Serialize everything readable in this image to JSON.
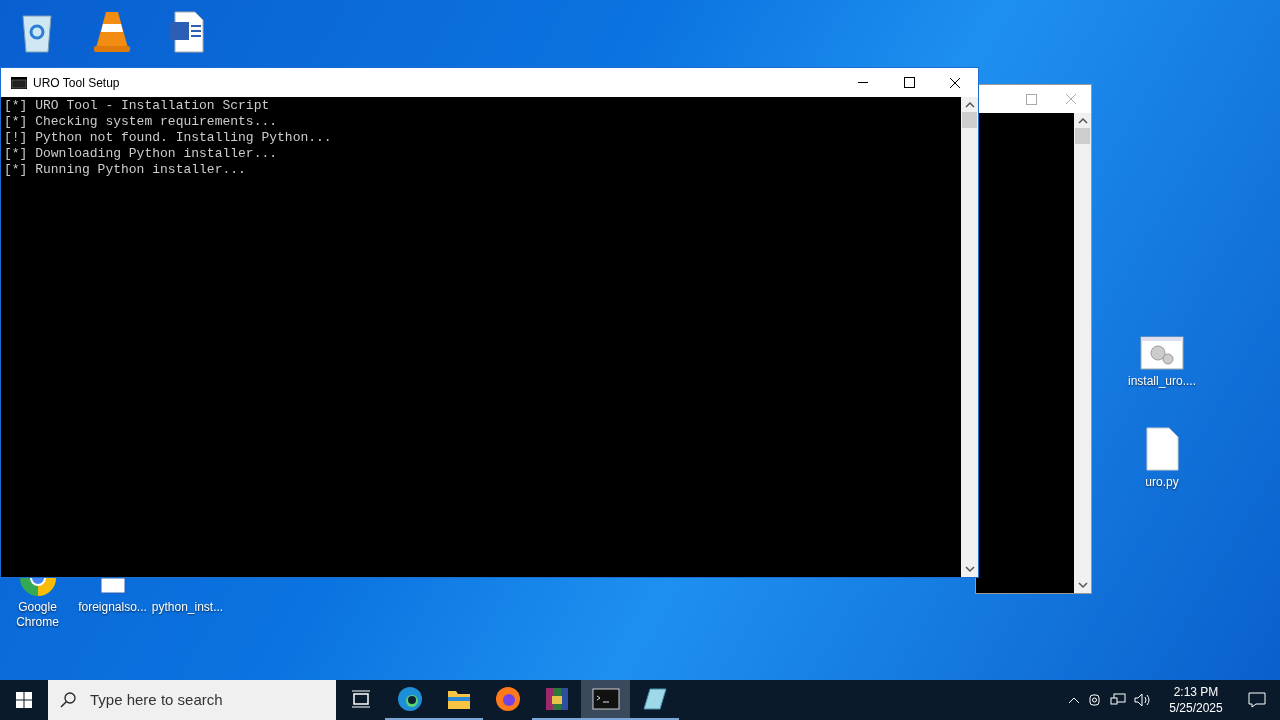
{
  "desktop_icons": [
    {
      "kind": "recycle"
    },
    {
      "kind": "vlc"
    },
    {
      "kind": "word"
    }
  ],
  "desktop_icons_bottom": [
    {
      "kind": "chrome",
      "label": "Google Chrome"
    },
    {
      "kind": "doc",
      "label": "foreignalso..."
    },
    {
      "kind": "blank",
      "label": "python_inst..."
    }
  ],
  "desktop_icons_right": [
    {
      "kind": "setup",
      "label": "install_uro...."
    },
    {
      "kind": "file",
      "label": "uro.py"
    }
  ],
  "console": {
    "title": "URO Tool Setup",
    "lines": [
      "[*] URO Tool - Installation Script",
      "[*] Checking system requirements...",
      "[!] Python not found. Installing Python...",
      "[*] Downloading Python installer...",
      "[*] Running Python installer..."
    ]
  },
  "taskbar": {
    "search": {
      "placeholder": "Type here to search"
    },
    "apps": [
      {
        "kind": "taskview",
        "running": false,
        "selected": false
      },
      {
        "kind": "edge",
        "running": true,
        "selected": false
      },
      {
        "kind": "explorer",
        "running": true,
        "selected": false
      },
      {
        "kind": "firefox",
        "running": false,
        "selected": false
      },
      {
        "kind": "winrar",
        "running": true,
        "selected": false
      },
      {
        "kind": "cmd",
        "running": true,
        "selected": true
      },
      {
        "kind": "notepad",
        "running": true,
        "selected": false
      }
    ],
    "time": "2:13 PM",
    "date": "5/25/2025"
  }
}
